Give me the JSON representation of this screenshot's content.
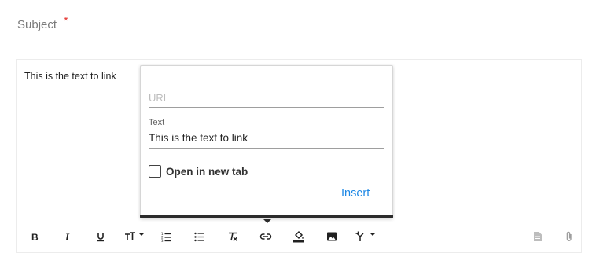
{
  "subject": {
    "label": "Subject",
    "required_marker": "*"
  },
  "editor": {
    "content_text": "This is the text to link"
  },
  "link_popup": {
    "url_placeholder": "URL",
    "url_value": "",
    "text_label": "Text",
    "text_value": "This is the text to link",
    "open_new_tab_label": "Open in new tab",
    "open_new_tab_checked": false,
    "insert_label": "Insert"
  },
  "toolbar": {
    "buttons": [
      {
        "name": "bold",
        "icon": "bold-icon"
      },
      {
        "name": "italic",
        "icon": "italic-icon"
      },
      {
        "name": "underline",
        "icon": "underline-icon"
      },
      {
        "name": "font-size",
        "icon": "font-size-icon",
        "has_dropdown": true
      },
      {
        "name": "ordered-list",
        "icon": "numbered-list-icon"
      },
      {
        "name": "bullet-list",
        "icon": "bulleted-list-icon"
      },
      {
        "name": "clear-formatting",
        "icon": "clear-format-icon"
      },
      {
        "name": "link",
        "icon": "link-icon"
      },
      {
        "name": "fill-color",
        "icon": "fill-color-icon"
      },
      {
        "name": "image",
        "icon": "image-icon"
      },
      {
        "name": "merge",
        "icon": "merge-icon",
        "has_dropdown": true
      },
      {
        "name": "file",
        "icon": "file-icon"
      },
      {
        "name": "attachment",
        "icon": "paperclip-icon"
      }
    ]
  },
  "colors": {
    "accent": "#1e88e5",
    "required": "#e53935",
    "popup_bar": "#2b2b2b"
  }
}
